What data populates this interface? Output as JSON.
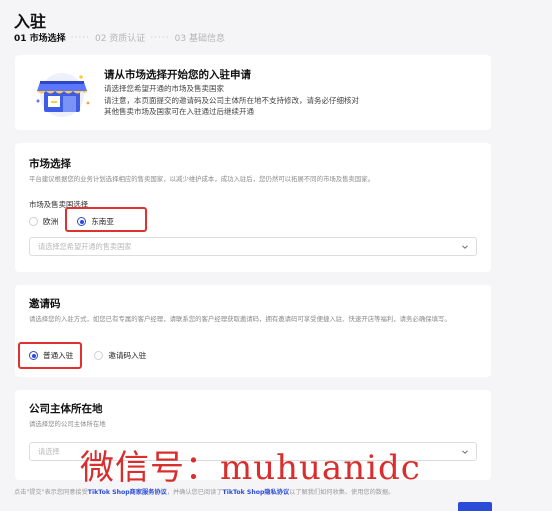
{
  "page": {
    "title": "入驻"
  },
  "steps": [
    {
      "label": "01 市场选择",
      "active": true
    },
    {
      "label": "02 资质认证",
      "active": false
    },
    {
      "label": "03 基础信息",
      "active": false
    }
  ],
  "intro": {
    "title": "请从市场选择开始您的入驻申请",
    "lines": [
      "请选择您希望开通的市场及售卖国家",
      "请注意，本页面提交的邀请码及公司主体所在地不支持修改，请务必仔细核对",
      "其他售卖市场及国家可在入驻通过后继续开通"
    ]
  },
  "market": {
    "title": "市场选择",
    "description": "平台建议根据您的业务计划选择相应的售卖国家，以减少维护成本，成功入驻后，您仍然可以拓展不同的市场及售卖国家。",
    "field_label": "市场及售卖国选择",
    "options": [
      {
        "label": "欧洲",
        "checked": false
      },
      {
        "label": "东南亚",
        "checked": true
      }
    ],
    "select_placeholder": "请选择您希望开通的售卖国家"
  },
  "invite": {
    "title": "邀请码",
    "description": "请选择您的入驻方式，如您已有专属的客户经理，请联系您的客户经理获取邀请码，拥有邀请码可享受便捷入驻、快速开店等福利，请务必确保填写。",
    "options": [
      {
        "label": "普通入驻",
        "checked": true
      },
      {
        "label": "邀请码入驻",
        "checked": false
      }
    ]
  },
  "company": {
    "title": "公司主体所在地",
    "description": "请选择您的公司主体所在地",
    "select_placeholder": "请选择"
  },
  "footer": {
    "prefix": "点击\"提交\"表示您同意接受",
    "link1": "TikTok Shop商家服务协议",
    "middle": "，并确认您已阅读了",
    "link2": "TikTok Shop隐私协议",
    "suffix": "以了解我们如何收集、使用您的数据。"
  },
  "watermark": {
    "text": "微信号：muhuanidc"
  },
  "colors": {
    "accent": "#2b4bd9",
    "highlight": "#e03131",
    "watermark": "#d61f1f"
  }
}
